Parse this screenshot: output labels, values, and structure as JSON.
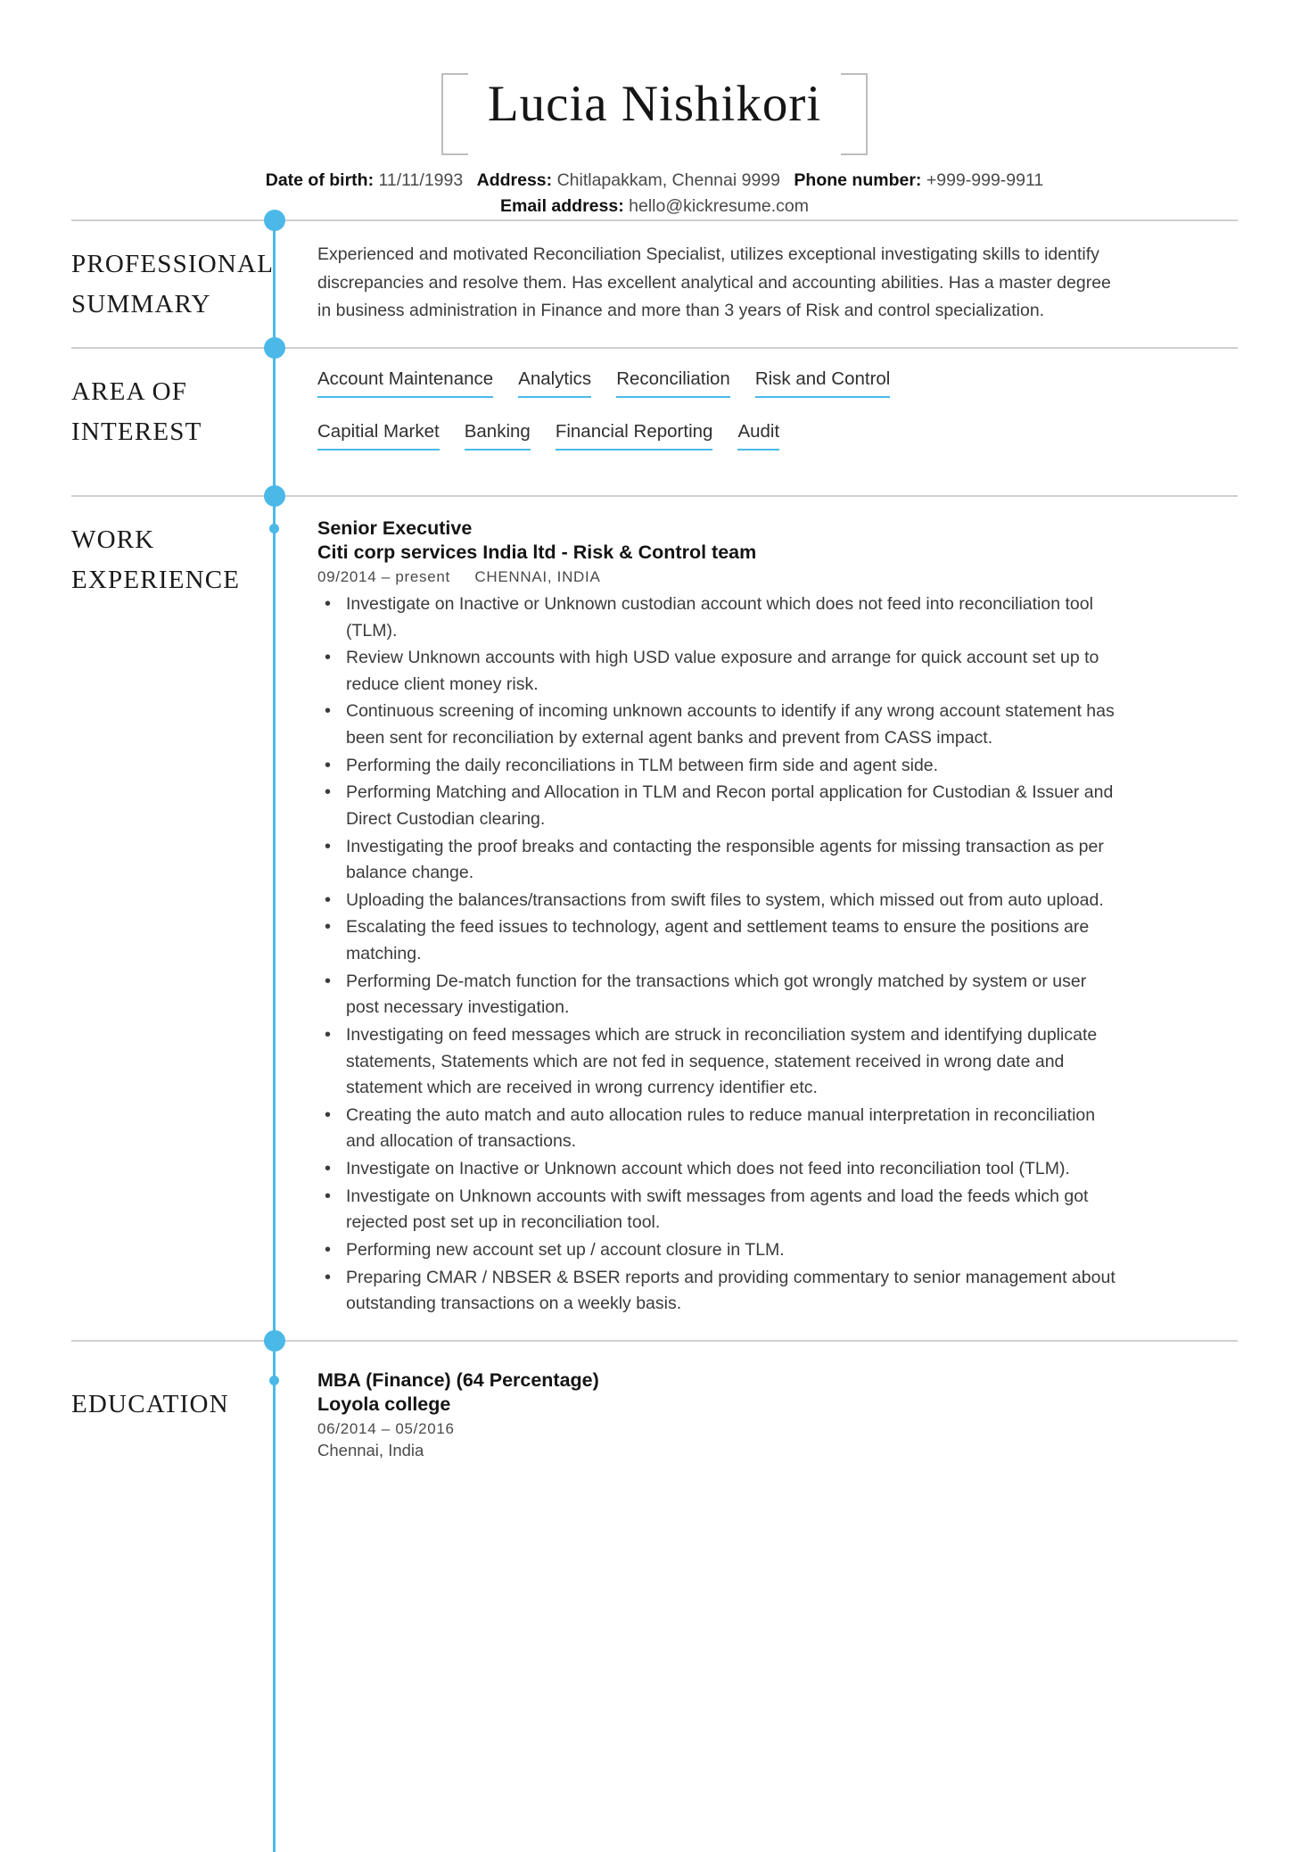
{
  "theme": {
    "accent": "#4ab9e8",
    "divider": "#cfcfcf",
    "text": "#3b3b3b",
    "heading": "#141414"
  },
  "header": {
    "name": "Lucia Nishikori",
    "contact": {
      "dob_label": "Date of birth:",
      "dob_value": "11/11/1993",
      "address_label": "Address:",
      "address_value": "Chitlapakkam, Chennai 9999",
      "phone_label": "Phone number:",
      "phone_value": "+999-999-9911",
      "email_label": "Email address:",
      "email_value": "hello@kickresume.com"
    }
  },
  "sections": {
    "summary": {
      "title_line1": "PROFESSIONAL",
      "title_line2": "SUMMARY",
      "text": "Experienced and motivated Reconciliation Specialist, utilizes exceptional investigating skills to identify discrepancies and resolve them. Has excellent analytical and accounting abilities. Has a master degree in business administration in Finance and more than 3 years of Risk and control specialization."
    },
    "interest": {
      "title_line1": "AREA OF",
      "title_line2": "INTEREST",
      "skills": [
        "Account Maintenance",
        "Analytics",
        "Reconciliation",
        "Risk and Control",
        "Capitial Market",
        "Banking",
        "Financial Reporting",
        "Audit"
      ]
    },
    "experience": {
      "title_line1": "WORK",
      "title_line2": "EXPERIENCE",
      "entries": [
        {
          "title": "Senior Executive",
          "org": "Citi corp services India ltd - Risk & Control team",
          "dates": "09/2014 – present",
          "location": "CHENNAI, INDIA",
          "bullets": [
            "Investigate on Inactive or Unknown custodian account which does not feed into reconciliation tool (TLM).",
            "Review Unknown accounts with high USD value exposure and arrange for quick account set up to reduce client money risk.",
            "Continuous screening of incoming unknown accounts to identify if any wrong account statement has been sent for reconciliation by external agent banks and prevent from CASS impact.",
            "Performing the daily reconciliations in TLM between firm side and agent side.",
            "Performing Matching and Allocation in TLM and Recon portal application for Custodian & Issuer and Direct Custodian clearing.",
            "Investigating the proof breaks and contacting the responsible agents for missing transaction as per balance change.",
            "Uploading the balances/transactions from swift files to system, which missed out from auto upload.",
            "Escalating the feed issues to technology, agent and settlement teams to ensure the positions are matching.",
            "Performing De-match function for the transactions which got wrongly matched by system or user post necessary investigation.",
            "Investigating on feed messages which are struck in reconciliation system and identifying duplicate statements, Statements which are not fed in sequence, statement received in wrong date and statement which are received in wrong currency identifier etc.",
            "Creating the auto match and auto allocation rules to reduce manual interpretation in reconciliation and allocation of transactions.",
            "Investigate on Inactive or Unknown account which does not feed into reconciliation tool (TLM).",
            "Investigate on Unknown accounts with swift messages from agents and load the feeds which got rejected post set up in reconciliation tool.",
            "Performing new account set up / account closure in TLM.",
            "Preparing CMAR / NBSER & BSER reports and providing commentary to senior management about outstanding transactions on a weekly basis."
          ]
        }
      ]
    },
    "education": {
      "title_line1": "EDUCATION",
      "entries": [
        {
          "title": "MBA (Finance) (64 Percentage)",
          "org": "Loyola college",
          "dates": "06/2014 – 05/2016",
          "location": "Chennai, India"
        }
      ]
    }
  }
}
